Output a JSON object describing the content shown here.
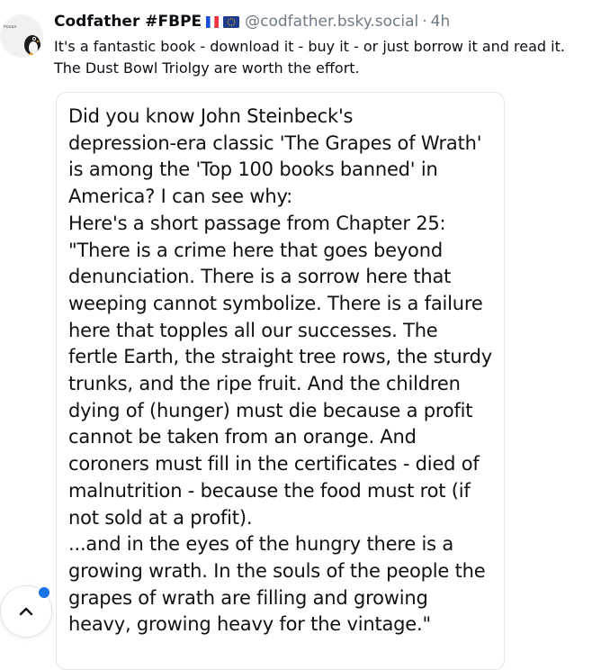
{
  "post": {
    "display_name": "Codfather #FBPE",
    "flags": [
      "france-flag",
      "eu-flag"
    ],
    "handle": "@codfather.bsky.social",
    "separator": "·",
    "timestamp": "4h",
    "text_lines": [
      "It's a fantastic book - download it - buy it - or just borrow it and read it.",
      "The Dust Bowl Triolgy are worth the effort."
    ]
  },
  "image": {
    "lines": [
      "Did you know John Steinbeck's",
      "depression-era classic 'The Grapes of Wrath'",
      "is among the 'Top 100 books banned' in",
      "America? I can see why:",
      "Here's a short passage from Chapter 25:",
      "\"There is a crime here that goes beyond",
      "denunciation. There is a sorrow here that",
      "weeping cannot symbolize. There is a failure",
      "here that topples all our successes. The",
      "fertle Earth, the straight tree rows, the sturdy",
      "trunks, and the ripe fruit. And the children",
      "dying of (hunger) must die because a profit",
      "cannot be taken from an orange. And",
      "coroners must fill in the certificates - died of",
      "malnutrition - because the food must rot (if",
      "not sold at a profit).",
      "...and in the eyes of the hungry there is a",
      "growing wrath. In the souls of the people the",
      "grapes of wrath are filling and growing",
      "heavy, growing heavy for the vintage.\""
    ]
  },
  "controls": {
    "scroll_top_icon": "chevron-up-icon",
    "notification_color": "#1a73e8"
  },
  "colors": {
    "muted_text": "#6f7b87",
    "body_text": "#0b0f14"
  }
}
